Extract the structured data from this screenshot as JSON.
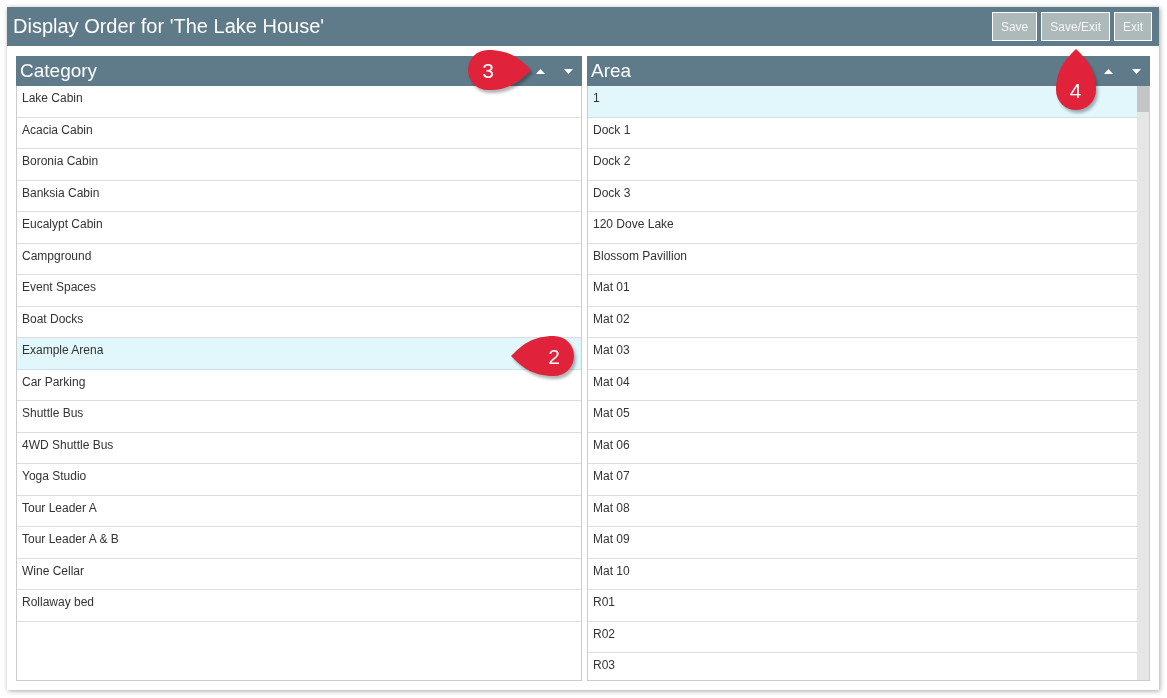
{
  "window": {
    "title": "Display Order for 'The Lake House'"
  },
  "buttons": [
    {
      "label": "Save"
    },
    {
      "label": "Save/Exit",
      "callout": {
        "label": "4"
      }
    },
    {
      "label": "Exit"
    }
  ],
  "panels": [
    {
      "title": "Category",
      "callout": {
        "label": "3"
      },
      "scrollbar": false,
      "items": [
        {
          "label": "Lake Cabin",
          "selected": false
        },
        {
          "label": "Acacia Cabin",
          "selected": false
        },
        {
          "label": "Boronia Cabin",
          "selected": false
        },
        {
          "label": "Banksia Cabin",
          "selected": false
        },
        {
          "label": "Eucalypt Cabin",
          "selected": false
        },
        {
          "label": "Campground",
          "selected": false
        },
        {
          "label": "Event Spaces",
          "selected": false
        },
        {
          "label": "Boat Docks",
          "selected": false
        },
        {
          "label": "Example Arena",
          "selected": true,
          "callout": {
            "label": "2"
          }
        },
        {
          "label": "Car Parking",
          "selected": false
        },
        {
          "label": "Shuttle Bus",
          "selected": false
        },
        {
          "label": "4WD Shuttle Bus",
          "selected": false
        },
        {
          "label": "Yoga Studio",
          "selected": false
        },
        {
          "label": "Tour Leader A",
          "selected": false
        },
        {
          "label": "Tour Leader A & B",
          "selected": false
        },
        {
          "label": "Wine Cellar",
          "selected": false
        },
        {
          "label": "Rollaway bed",
          "selected": false
        }
      ]
    },
    {
      "title": "Area",
      "scrollbar": true,
      "items": [
        {
          "label": "1",
          "selected": true
        },
        {
          "label": "Dock 1",
          "selected": false
        },
        {
          "label": "Dock 2",
          "selected": false
        },
        {
          "label": "Dock 3",
          "selected": false
        },
        {
          "label": "120 Dove Lake",
          "selected": false
        },
        {
          "label": "Blossom Pavillion",
          "selected": false
        },
        {
          "label": "Mat 01",
          "selected": false
        },
        {
          "label": "Mat 02",
          "selected": false
        },
        {
          "label": "Mat 03",
          "selected": false
        },
        {
          "label": "Mat 04",
          "selected": false
        },
        {
          "label": "Mat 05",
          "selected": false
        },
        {
          "label": "Mat 06",
          "selected": false
        },
        {
          "label": "Mat 07",
          "selected": false
        },
        {
          "label": "Mat 08",
          "selected": false
        },
        {
          "label": "Mat 09",
          "selected": false
        },
        {
          "label": "Mat 10",
          "selected": false
        },
        {
          "label": "R01",
          "selected": false
        },
        {
          "label": "R02",
          "selected": false
        },
        {
          "label": "R03",
          "selected": false
        }
      ]
    }
  ]
}
